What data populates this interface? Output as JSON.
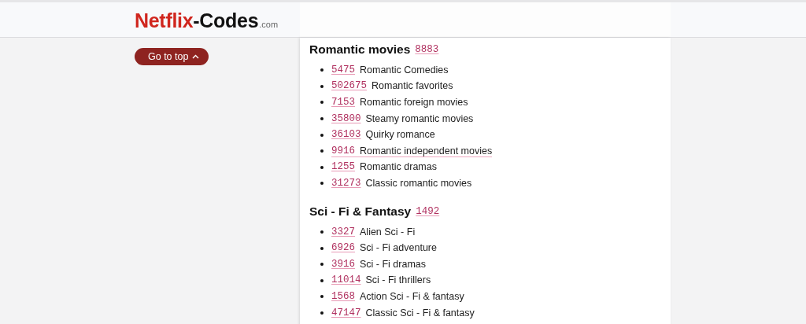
{
  "header": {
    "logo": {
      "brand": "Netflix",
      "suffix": "-Codes",
      "tld": ".com"
    }
  },
  "sidebar": {
    "go_to_top": {
      "label": "Go to top"
    }
  },
  "sections": [
    {
      "title": "Romantic movies",
      "code": "8883",
      "items": [
        {
          "code": "5475",
          "name": "Romantic Comedies",
          "hovered": false
        },
        {
          "code": "502675",
          "name": "Romantic favorites",
          "hovered": false
        },
        {
          "code": "7153",
          "name": "Romantic foreign movies",
          "hovered": false
        },
        {
          "code": "35800",
          "name": "Steamy romantic movies",
          "hovered": false
        },
        {
          "code": "36103",
          "name": "Quirky romance",
          "hovered": false
        },
        {
          "code": "9916",
          "name": "Romantic independent movies",
          "hovered": true
        },
        {
          "code": "1255",
          "name": "Romantic dramas",
          "hovered": false
        },
        {
          "code": "31273",
          "name": "Classic romantic movies",
          "hovered": false
        }
      ]
    },
    {
      "title": "Sci - Fi & Fantasy",
      "code": "1492",
      "items": [
        {
          "code": "3327",
          "name": "Alien Sci - Fi",
          "hovered": false
        },
        {
          "code": "6926",
          "name": "Sci - Fi adventure",
          "hovered": false
        },
        {
          "code": "3916",
          "name": "Sci - Fi dramas",
          "hovered": false
        },
        {
          "code": "11014",
          "name": "Sci - Fi thrillers",
          "hovered": false
        },
        {
          "code": "1568",
          "name": "Action Sci - Fi & fantasy",
          "hovered": false
        },
        {
          "code": "47147",
          "name": "Classic Sci - Fi & fantasy",
          "hovered": false
        }
      ]
    }
  ]
}
